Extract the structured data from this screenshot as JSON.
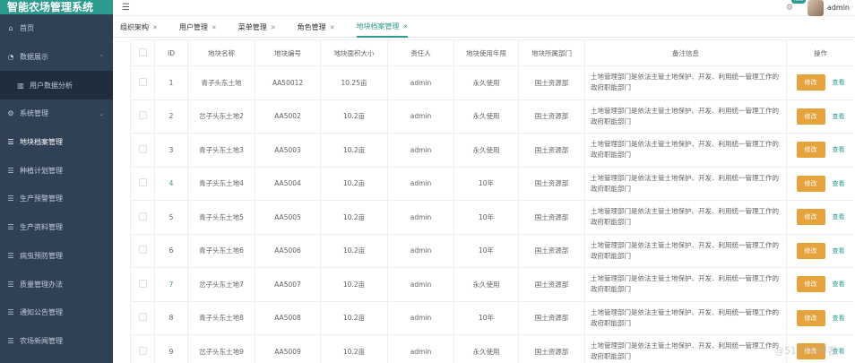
{
  "app": {
    "title": "智能农场管理系统"
  },
  "header": {
    "username": "admin",
    "badge": "new"
  },
  "sidebar": {
    "items": [
      {
        "label": "首页",
        "icon": "home-icon"
      },
      {
        "label": "数据展示",
        "icon": "chart-icon",
        "arrow": "⌃"
      },
      {
        "label": "用户数据分析",
        "icon": "bar-chart-icon"
      },
      {
        "label": "系统管理",
        "icon": "gear-icon",
        "arrow": "⌄"
      },
      {
        "label": "地块档案管理",
        "icon": "list-icon"
      },
      {
        "label": "种植计划管理",
        "icon": "list-icon"
      },
      {
        "label": "生产预警管理",
        "icon": "list-icon"
      },
      {
        "label": "生产资料管理",
        "icon": "list-icon"
      },
      {
        "label": "病虫预防管理",
        "icon": "list-icon"
      },
      {
        "label": "质量管理办法",
        "icon": "list-icon"
      },
      {
        "label": "通知公告管理",
        "icon": "list-icon"
      },
      {
        "label": "农场新闻管理",
        "icon": "list-icon"
      }
    ]
  },
  "tabs": [
    {
      "label": "组织架构"
    },
    {
      "label": "用户管理"
    },
    {
      "label": "菜单管理"
    },
    {
      "label": "角色管理"
    },
    {
      "label": "地块档案管理"
    }
  ],
  "table": {
    "headers": [
      "",
      "ID",
      "地块名称",
      "地块编号",
      "地块面积大小",
      "责任人",
      "地块使用年限",
      "地块所属部门",
      "备注信息",
      "操作"
    ],
    "edit_label": "修改",
    "view_label": "查看",
    "rows": [
      {
        "id": "1",
        "name": "青子头东土地",
        "code": "AA50012",
        "area": "10.25亩",
        "owner": "admin",
        "years": "永久使用",
        "dept": "国土资源部",
        "remark": "土地管理部门是依法主管土地保护、开发、利用统一管理工作的政府职能部门"
      },
      {
        "id": "2",
        "name": "岔子头东土地2",
        "code": "AA5002",
        "area": "10.2亩",
        "owner": "admin",
        "years": "永久使用",
        "dept": "国土资源部",
        "remark": "土地管理部门是依法主管土地保护、开发、利用统一管理工作的政府职能部门"
      },
      {
        "id": "3",
        "name": "青子头东土地3",
        "code": "AA5003",
        "area": "10.2亩",
        "owner": "admin",
        "years": "永久使用",
        "dept": "国土资源部",
        "remark": "土地管理部门是依法主管土地保护、开发、利用统一管理工作的政府职能部门"
      },
      {
        "id": "4",
        "name": "青子头东土地4",
        "code": "AA5004",
        "area": "10.2亩",
        "owner": "admin",
        "years": "10年",
        "dept": "国土资源部",
        "remark": "土地管理部门是依法主管土地保护、开发、利用统一管理工作的政府职能部门"
      },
      {
        "id": "5",
        "name": "青子头东土地5",
        "code": "AA5005",
        "area": "10.2亩",
        "owner": "admin",
        "years": "10年",
        "dept": "国土资源部",
        "remark": "土地管理部门是依法主管土地保护、开发、利用统一管理工作的政府职能部门"
      },
      {
        "id": "6",
        "name": "青子头东土地6",
        "code": "AA5006",
        "area": "10.2亩",
        "owner": "admin",
        "years": "10年",
        "dept": "国土资源部",
        "remark": "土地管理部门是依法主管土地保护、开发、利用统一管理工作的政府职能部门"
      },
      {
        "id": "7",
        "name": "岔子头东土地7",
        "code": "AA5007",
        "area": "10.2亩",
        "owner": "admin",
        "years": "永久使用",
        "dept": "国土资源部",
        "remark": "土地管理部门是依法主管土地保护、开发、利用统一管理工作的政府职能部门"
      },
      {
        "id": "8",
        "name": "青子头东土地8",
        "code": "AA5008",
        "area": "10.2亩",
        "owner": "admin",
        "years": "10年",
        "dept": "国土资源部",
        "remark": "土地管理部门是依法主管土地保护、开发、利用统一管理工作的政府职能部门"
      },
      {
        "id": "9",
        "name": "岔子头东土地9",
        "code": "AA5009",
        "area": "10.2亩",
        "owner": "admin",
        "years": "永久使用",
        "dept": "国土资源部",
        "remark": "土地管理部门是依法主管土地保护、开发、利用统一管理工作的政府职能部门"
      }
    ]
  },
  "watermark": "@51CTO博客",
  "colors": {
    "accent": "#2d9c8f",
    "sidebar_bg": "#304156",
    "edit_button": "#e6a23c"
  }
}
